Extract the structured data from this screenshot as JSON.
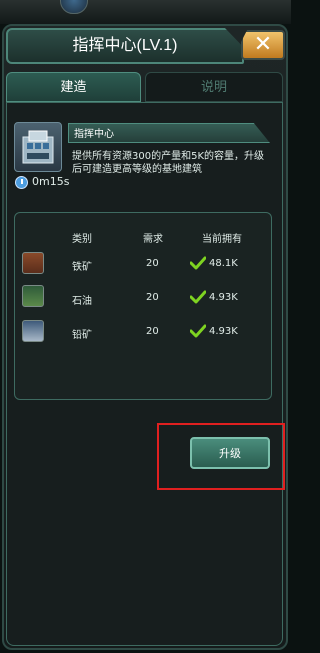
{
  "window": {
    "title": "指挥中心(LV.1)",
    "close_symbol": "✕"
  },
  "tabs": [
    {
      "label": "建造",
      "active": true
    },
    {
      "label": "说明",
      "active": false
    }
  ],
  "building": {
    "icon": "building-icon",
    "time_icon": "clock-icon",
    "time": "0m15s",
    "name": "指挥中心",
    "description": "提供所有资源300的产量和5K的容量，升级后可建造更高等级的基地建筑"
  },
  "requirements": {
    "headers": {
      "category": "类别",
      "required": "需求",
      "owned": "当前拥有"
    },
    "rows": [
      {
        "icon": "iron-ore-icon",
        "name": "铁矿",
        "required": "20",
        "owned": "48.1K",
        "met": true
      },
      {
        "icon": "oil-icon",
        "name": "石油",
        "required": "20",
        "owned": "4.93K",
        "met": true
      },
      {
        "icon": "lead-ore-icon",
        "name": "铅矿",
        "required": "20",
        "owned": "4.93K",
        "met": true
      }
    ]
  },
  "actions": {
    "upgrade_label": "升级"
  },
  "colors": {
    "accent": "#4f8d7f",
    "check": "#7ed321",
    "highlight": "#e02020",
    "close_button": "#e0a040"
  }
}
